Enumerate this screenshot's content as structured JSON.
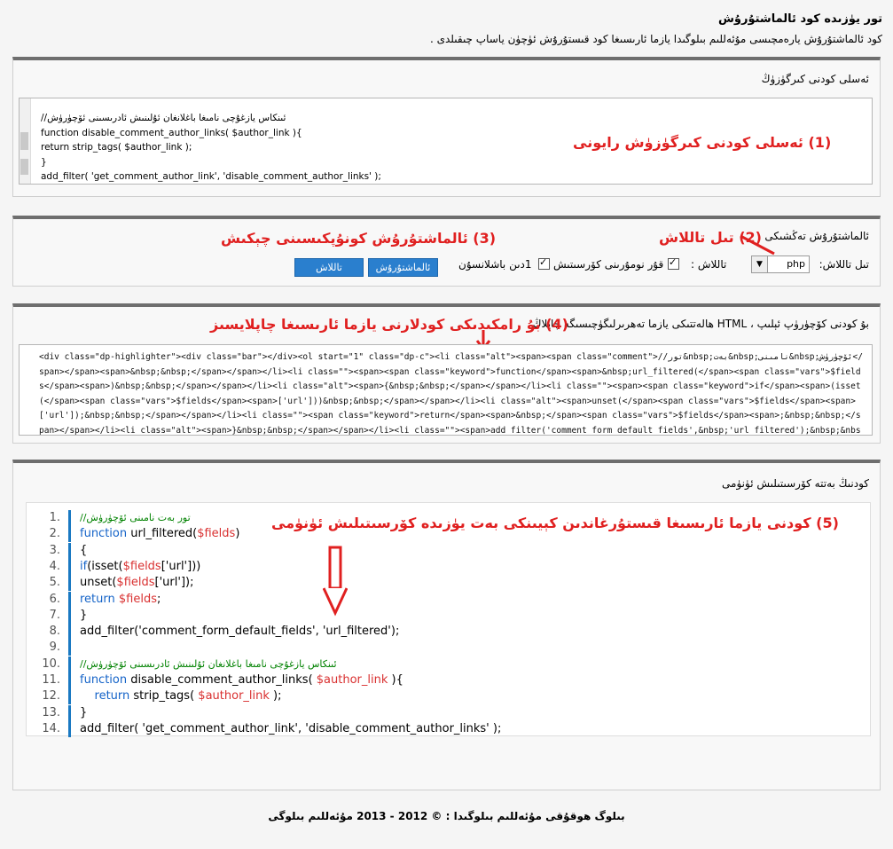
{
  "header": {
    "title": "تور يۈزىدە كود ئالماشتۇرۇش",
    "subtitle": "كود ئالماشتۇرۇش يارەمچىسى مۇئەللىم بىلوگىدا يازما ئارىسىغا كود قىستۇرۇش ئۈچۈن ياساپ چىقىلدى ."
  },
  "panel1": {
    "title": "ئەسلى كودنى كىرگۈزۈڭ",
    "code_lines": [
      "//ئىنكاس يازغۇچى نامىغا باغلانغان ئۇلىنىش ئادرىسىنى ئۆچۈرۈش",
      "function disable_comment_author_links( $author_link ){",
      "return strip_tags( $author_link );",
      "}",
      "add_filter( 'get_comment_author_link', 'disable_comment_author_links' );"
    ],
    "note": "(1) ئەسلى كودنى كىرگۈزۈش رايونى"
  },
  "panel2": {
    "title": "ئالماشتۇرۇش تەڭشىكى",
    "note_lang": "(2) تىل تاللاش",
    "note_convert": "(3) ئالماشتۇرۇش كونۇپكىسىنى چېكىش",
    "lang_label": "تىل تاللاش:",
    "lang_value": "php",
    "options_label": "تاللاش :",
    "opt_show_lines": "قۇر نومۇرىنى كۆرسىتىش",
    "opt_start_one": "1دىن باشلانسۇن",
    "convert_button": "ئالماشتۇرۇش",
    "select_button": "تاللاش"
  },
  "panel3": {
    "title": "بۇ كودنى كۆچۈرۈپ ئېلىپ ، HTML ھالەتتىكى يازما تەھرىرلىگۈچىسىگە چاپلاڭ",
    "note": "(4) بۇ رامكىدىكى كودلارنى يازما ئارىسىغا چاپلايسىز",
    "escaped_text": "<div class=\"dp-highlighter\"><div class=\"bar\"></div><ol start=\"1\" class=\"dp-c\"><li class=\"alt\"><span><span class=\"comment\">//تور&nbsp;بەت&nbsp;نامىنى&nbsp;ئۆچۈرۈش</span></span><span>&nbsp;&nbsp;</span></span></li><li class=\"\"><span><span class=\"keyword\">function</span><span>&nbsp;url_filtered(</span><span class=\"vars\">$fields</span><span>)&nbsp;&nbsp;</span></span></li><li class=\"alt\"><span>{&nbsp;&nbsp;</span></span></li><li class=\"\"><span><span class=\"keyword\">if</span><span>(isset(</span><span class=\"vars\">$fields</span><span>['url']))&nbsp;&nbsp;</span></span></li><li class=\"alt\"><span>unset(</span><span class=\"vars\">$fields</span><span>['url']);&nbsp;&nbsp;</span></span></li><li class=\"\"><span class=\"keyword\">return</span><span>&nbsp;</span><span class=\"vars\">$fields</span><span>;&nbsp;&nbsp;</span></span></li><li class=\"alt\"><span>}&nbsp;&nbsp;</span></span></li><li class=\"\"><span>add_filter('comment_form_default_fields',&nbsp;'url_filtered');&nbsp;&nbsp;</span></li><li class=\"alt\"><span>&nbsp;&nbsp;&nbsp;&nbsp;</span></li><li class=\"\"><span><span"
  },
  "panel4": {
    "title": "كودنىڭ بەتتە كۆرسىتىلىش ئۈنۈمى",
    "note": "(5) كودنى يازما ئارىسىغا قىستۇرغاندىن كېيىنكى بەت يۈزىدە كۆرسىتىلىش ئۈنۈمى",
    "lines": [
      {
        "num": "1.",
        "parts": [
          {
            "cls": "c-comment",
            "t": "//تور بەت نامىنى ئۆچۈرۈش"
          }
        ]
      },
      {
        "num": "2.",
        "parts": [
          {
            "cls": "c-kw",
            "t": "function"
          },
          {
            "cls": "",
            "t": " url_filtered("
          },
          {
            "cls": "c-var",
            "t": "$fields"
          },
          {
            "cls": "",
            "t": ")"
          }
        ]
      },
      {
        "num": "3.",
        "parts": [
          {
            "cls": "",
            "t": "{"
          }
        ]
      },
      {
        "num": "4.",
        "parts": [
          {
            "cls": "c-kw",
            "t": "if"
          },
          {
            "cls": "",
            "t": "(isset("
          },
          {
            "cls": "c-var",
            "t": "$fields"
          },
          {
            "cls": "",
            "t": "['url']))"
          }
        ]
      },
      {
        "num": "5.",
        "parts": [
          {
            "cls": "",
            "t": "unset("
          },
          {
            "cls": "c-var",
            "t": "$fields"
          },
          {
            "cls": "",
            "t": "['url']);"
          }
        ]
      },
      {
        "num": "6.",
        "parts": [
          {
            "cls": "c-kw",
            "t": "return"
          },
          {
            "cls": "",
            "t": " "
          },
          {
            "cls": "c-var",
            "t": "$fields"
          },
          {
            "cls": "",
            "t": ";"
          }
        ]
      },
      {
        "num": "7.",
        "parts": [
          {
            "cls": "",
            "t": "}"
          }
        ]
      },
      {
        "num": "8.",
        "parts": [
          {
            "cls": "",
            "t": "add_filter('comment_form_default_fields', 'url_filtered');"
          }
        ]
      },
      {
        "num": "9.",
        "parts": [
          {
            "cls": "",
            "t": ""
          }
        ]
      },
      {
        "num": "10.",
        "parts": [
          {
            "cls": "c-comment",
            "t": "//ئىنكاس يازغۇچى نامىغا باغلانغان ئۇلىنىش ئادرىسىنى ئۆچۈرۈش"
          }
        ]
      },
      {
        "num": "11.",
        "parts": [
          {
            "cls": "c-kw",
            "t": "function"
          },
          {
            "cls": "",
            "t": " disable_comment_author_links( "
          },
          {
            "cls": "c-var",
            "t": "$author_link"
          },
          {
            "cls": "",
            "t": " ){"
          }
        ]
      },
      {
        "num": "12.",
        "parts": [
          {
            "cls": "",
            "t": "    "
          },
          {
            "cls": "c-kw",
            "t": "return"
          },
          {
            "cls": "",
            "t": " strip_tags( "
          },
          {
            "cls": "c-var",
            "t": "$author_link"
          },
          {
            "cls": "",
            "t": " );"
          }
        ]
      },
      {
        "num": "13.",
        "parts": [
          {
            "cls": "",
            "t": "}"
          }
        ]
      },
      {
        "num": "14.",
        "parts": [
          {
            "cls": "",
            "t": "add_filter( 'get_comment_author_link', 'disable_comment_author_links' );"
          }
        ]
      }
    ]
  },
  "footer": "بىلوگ ھوقۇقى مۇئەللىم بىلوگىدا : © 2012 - 2013 مۇئەللىم بىلوگى",
  "colors": {
    "accent": "#2a7fce",
    "note_red": "#e02020",
    "panel_border": "#6e6e6e"
  }
}
